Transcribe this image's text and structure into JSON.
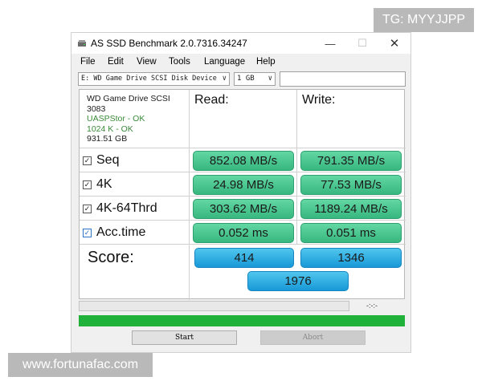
{
  "overlay": {
    "tg_tag": "TG: MYYJJPP",
    "website": "www.fortunafac.com"
  },
  "window": {
    "title": "AS SSD Benchmark 2.0.7316.34247",
    "controls": {
      "minimize": "—",
      "maximize": "☐",
      "close": "✕"
    }
  },
  "menu": [
    "File",
    "Edit",
    "View",
    "Tools",
    "Language",
    "Help"
  ],
  "toolbar": {
    "drive_select": "E: WD Game Drive SCSI Disk Device",
    "size_select": "1 GB",
    "text_field_value": ""
  },
  "drive_info": {
    "name": "WD Game Drive SCSI",
    "id": "3083",
    "driver": "UASPStor - OK",
    "alignment": "1024 K - OK",
    "capacity": "931.51 GB"
  },
  "columns": {
    "read": "Read:",
    "write": "Write:"
  },
  "tests": [
    {
      "label": "Seq",
      "read": "852.08 MB/s",
      "write": "791.35 MB/s",
      "checked": true
    },
    {
      "label": "4K",
      "read": "24.98 MB/s",
      "write": "77.53 MB/s",
      "checked": true
    },
    {
      "label": "4K-64Thrd",
      "read": "303.62 MB/s",
      "write": "1189.24 MB/s",
      "checked": true
    },
    {
      "label": "Acc.time",
      "read": "0.052 ms",
      "write": "0.051 ms",
      "checked": true
    }
  ],
  "score": {
    "label": "Score:",
    "read": "414",
    "write": "1346",
    "total": "1976"
  },
  "status": {
    "elapsed": "-:-:-",
    "progress_fraction": 1.0
  },
  "buttons": {
    "start": "Start",
    "abort": "Abort"
  },
  "colors": {
    "result_green": "#37b77f",
    "score_blue": "#1898d6",
    "progress_green": "#20b13a",
    "ok_text": "#3a8a3a"
  }
}
